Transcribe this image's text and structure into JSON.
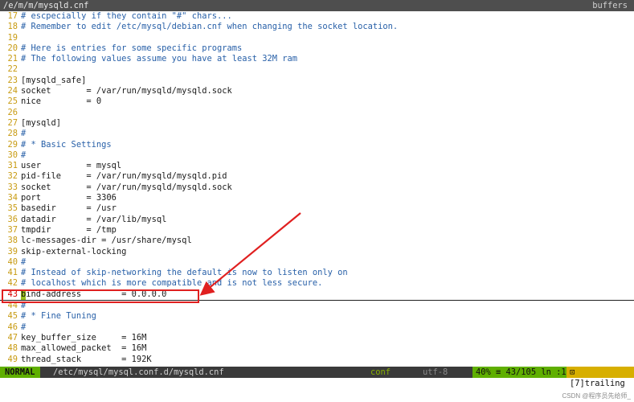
{
  "tabline": {
    "active_tab": "/e/m/m/mysqld.cnf",
    "right_label": "buffers"
  },
  "lines": [
    {
      "n": "17",
      "text": "# escpecially if they contain \"#\" chars...",
      "kind": "comment"
    },
    {
      "n": "18",
      "text": "# Remember to edit /etc/mysql/debian.cnf when changing the socket location.",
      "kind": "comment"
    },
    {
      "n": "19",
      "text": "",
      "kind": "text"
    },
    {
      "n": "20",
      "text": "# Here is entries for some specific programs",
      "kind": "comment"
    },
    {
      "n": "21",
      "text": "# The following values assume you have at least 32M ram",
      "kind": "comment"
    },
    {
      "n": "22",
      "text": "",
      "kind": "text"
    },
    {
      "n": "23",
      "text": "[mysqld_safe]",
      "kind": "text"
    },
    {
      "n": "24",
      "text": "socket       = /var/run/mysqld/mysqld.sock",
      "kind": "text"
    },
    {
      "n": "25",
      "text": "nice         = 0",
      "kind": "text"
    },
    {
      "n": "26",
      "text": "",
      "kind": "text"
    },
    {
      "n": "27",
      "text": "[mysqld]",
      "kind": "text"
    },
    {
      "n": "28",
      "text": "#",
      "kind": "comment"
    },
    {
      "n": "29",
      "text": "# * Basic Settings",
      "kind": "comment"
    },
    {
      "n": "30",
      "text": "#",
      "kind": "comment"
    },
    {
      "n": "31",
      "text": "user         = mysql",
      "kind": "text"
    },
    {
      "n": "32",
      "text": "pid-file     = /var/run/mysqld/mysqld.pid",
      "kind": "text"
    },
    {
      "n": "33",
      "text": "socket       = /var/run/mysqld/mysqld.sock",
      "kind": "text"
    },
    {
      "n": "34",
      "text": "port         = 3306",
      "kind": "text"
    },
    {
      "n": "35",
      "text": "basedir      = /usr",
      "kind": "text"
    },
    {
      "n": "36",
      "text": "datadir      = /var/lib/mysql",
      "kind": "text"
    },
    {
      "n": "37",
      "text": "tmpdir       = /tmp",
      "kind": "text"
    },
    {
      "n": "38",
      "text": "lc-messages-dir = /usr/share/mysql",
      "kind": "text"
    },
    {
      "n": "39",
      "text": "skip-external-locking",
      "kind": "text"
    },
    {
      "n": "40",
      "text": "#",
      "kind": "comment"
    },
    {
      "n": "41",
      "text": "# Instead of skip-networking the default is now to listen only on",
      "kind": "comment"
    },
    {
      "n": "42",
      "text": "# localhost which is more compatible and is not less secure.",
      "kind": "comment"
    },
    {
      "n": "43",
      "text": "ind-address        = 0.0.0.0",
      "cursor_char": "b",
      "kind": "cursor"
    },
    {
      "n": "44",
      "text": "#",
      "kind": "comment"
    },
    {
      "n": "45",
      "text": "# * Fine Tuning",
      "kind": "comment"
    },
    {
      "n": "46",
      "text": "#",
      "kind": "comment"
    },
    {
      "n": "47",
      "text": "key_buffer_size     = 16M",
      "kind": "text"
    },
    {
      "n": "48",
      "text": "max_allowed_packet  = 16M",
      "kind": "text"
    },
    {
      "n": "49",
      "text": "thread_stack        = 192K",
      "kind": "text"
    }
  ],
  "statusline": {
    "mode": "NORMAL",
    "path": "/etc/mysql/mysql.conf.d/mysqld.cnf",
    "filetype": "conf",
    "encoding": "utf-8",
    "position": "40% ≡ 43/105 ln :1",
    "trailing": "⊡ [7]trailing"
  },
  "watermark": "CSDN @程序员先给师_",
  "colors": {
    "line_number": "#c89b12",
    "comment": "#2860a8",
    "annotation_red": "#e02020",
    "mode_green": "#5faf00"
  }
}
